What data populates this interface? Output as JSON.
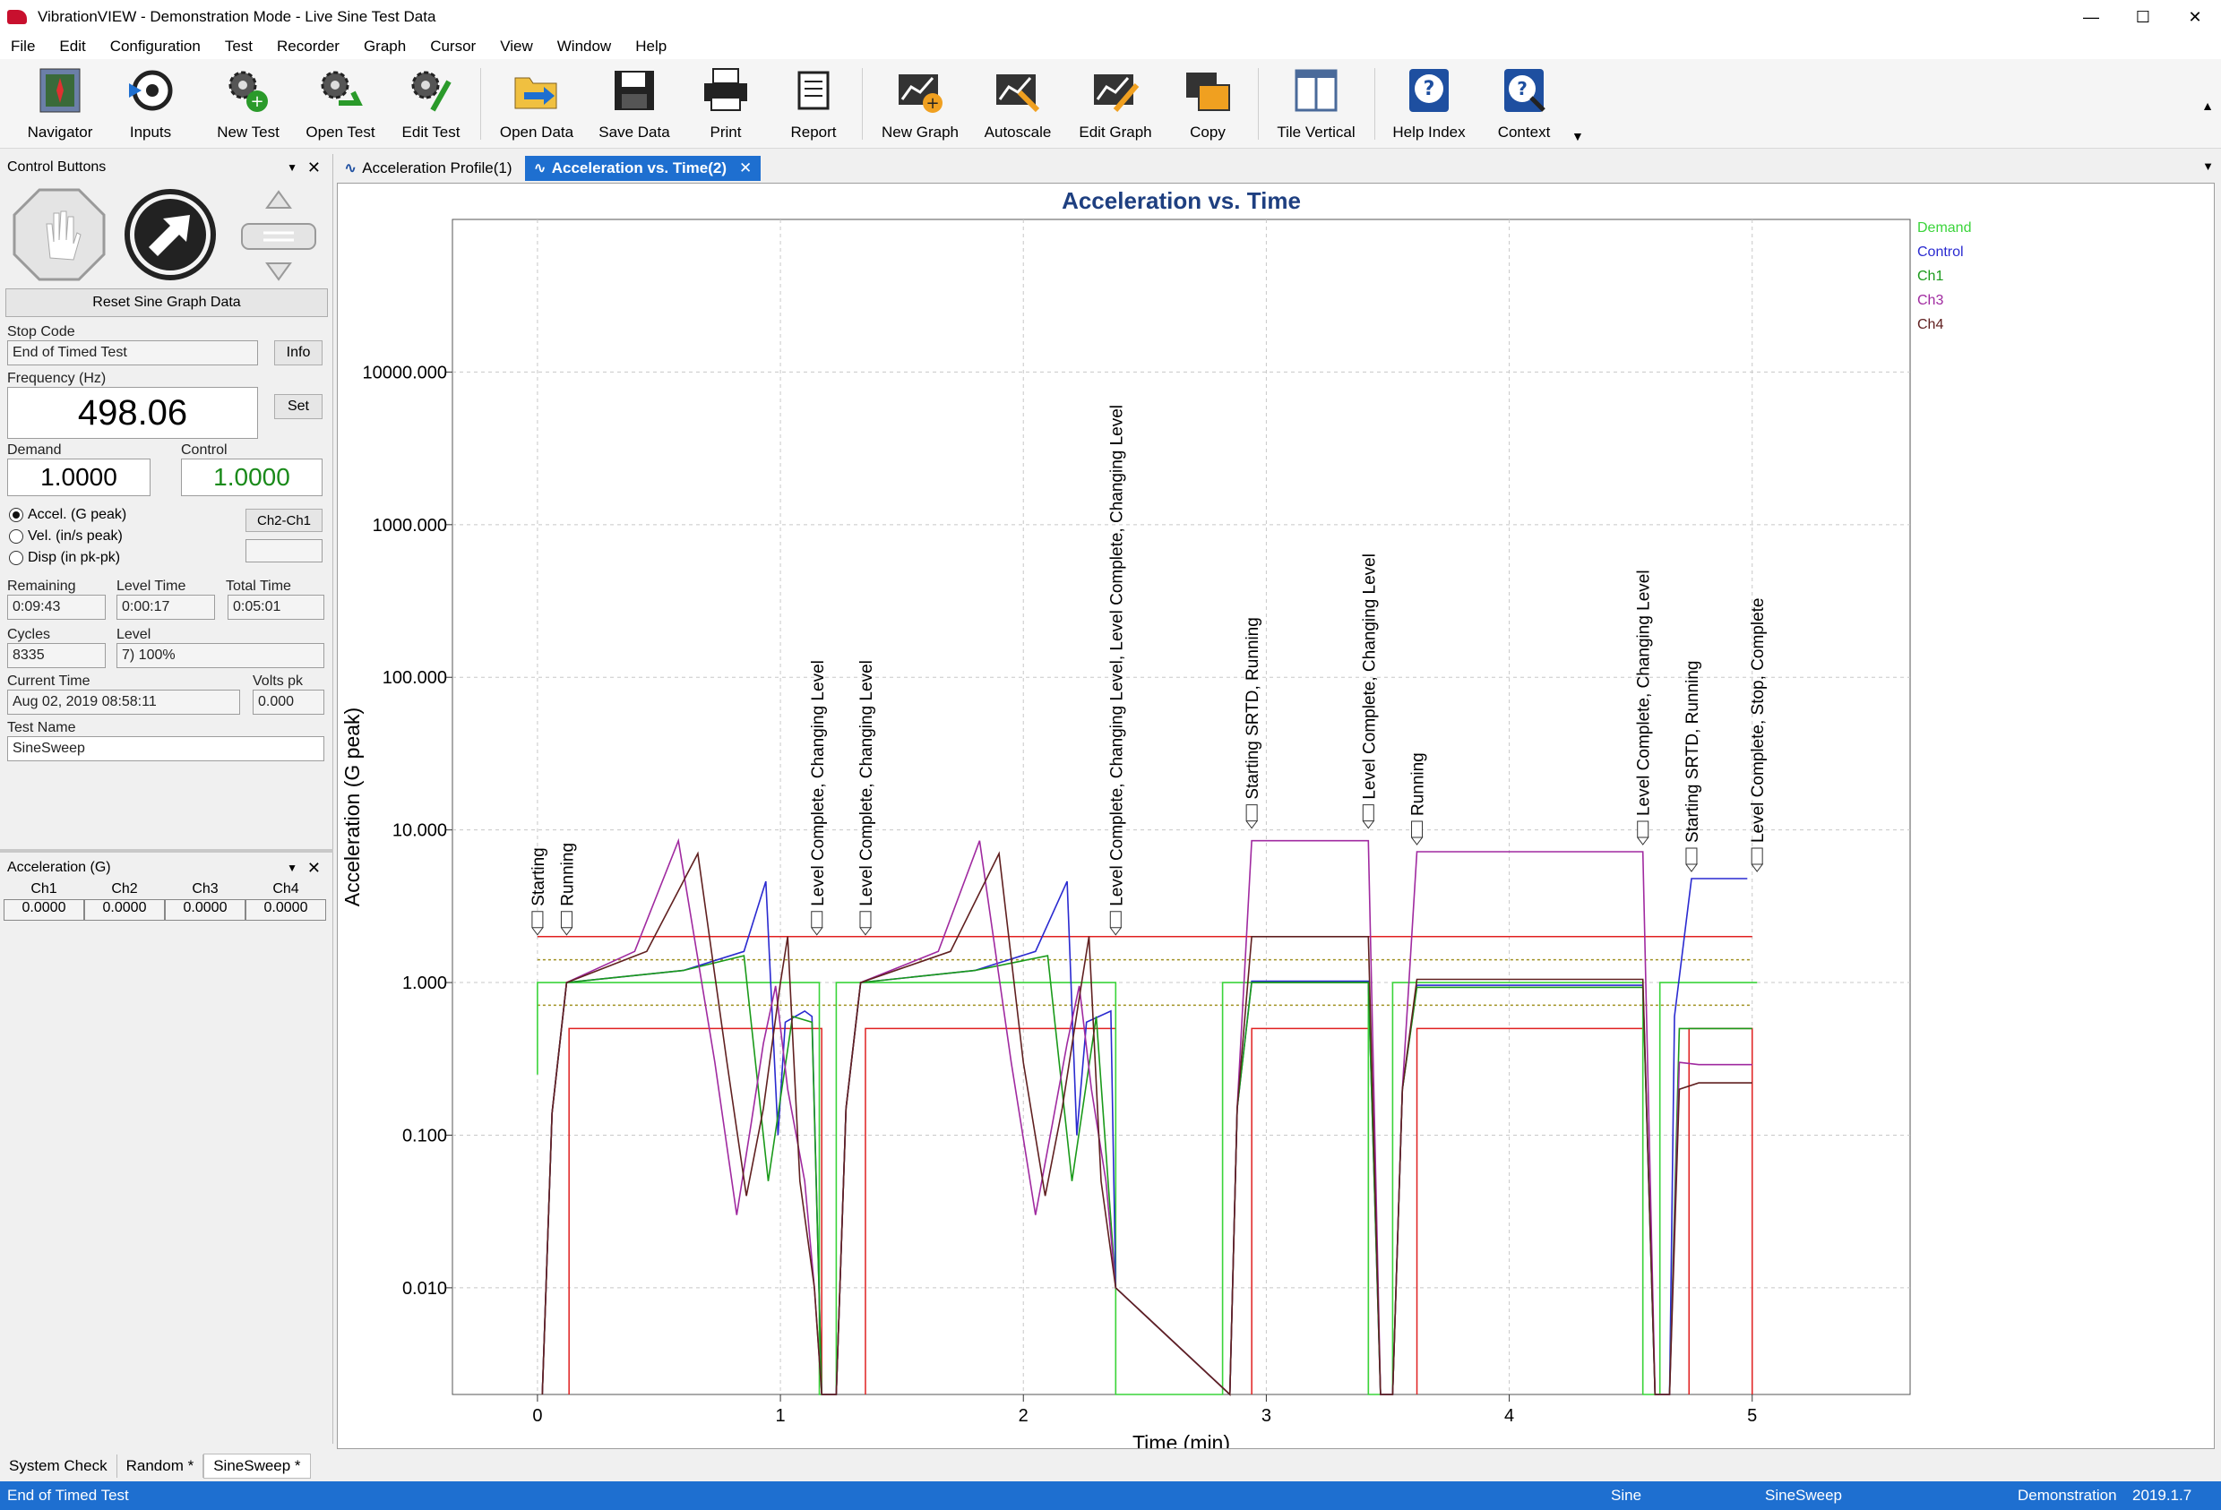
{
  "window": {
    "title": "VibrationVIEW - Demonstration Mode - Live Sine Test Data"
  },
  "menu": [
    "File",
    "Edit",
    "Configuration",
    "Test",
    "Recorder",
    "Graph",
    "Cursor",
    "View",
    "Window",
    "Help"
  ],
  "toolbar": {
    "navigator": "Navigator",
    "inputs": "Inputs",
    "new_test": "New Test",
    "open_test": "Open Test",
    "edit_test": "Edit Test",
    "open_data": "Open Data",
    "save_data": "Save Data",
    "print": "Print",
    "report": "Report",
    "new_graph": "New Graph",
    "autoscale": "Autoscale",
    "edit_graph": "Edit Graph",
    "copy": "Copy",
    "tile_vertical": "Tile Vertical",
    "help_index": "Help Index",
    "context": "Context"
  },
  "control_panel": {
    "title": "Control Buttons",
    "reset_label": "Reset Sine Graph Data",
    "stop_code_label": "Stop Code",
    "stop_code": "End of Timed Test",
    "info": "Info",
    "frequency_label": "Frequency (Hz)",
    "frequency": "498.06",
    "set": "Set",
    "demand_label": "Demand",
    "demand": "1.0000",
    "control_label": "Control",
    "control": "1.0000",
    "units": [
      "Accel.  (G peak)",
      "Vel.  (in/s peak)",
      "Disp (in pk-pk)"
    ],
    "ch_diff": "Ch2-Ch1",
    "remaining_label": "Remaining",
    "remaining": "0:09:43",
    "level_time_label": "Level Time",
    "level_time": "0:00:17",
    "total_time_label": "Total Time",
    "total_time": "0:05:01",
    "cycles_label": "Cycles",
    "cycles": "8335",
    "level_label": "Level",
    "level": "7) 100%",
    "current_time_label": "Current Time",
    "current_time": "Aug 02, 2019 08:58:11",
    "volts_label": "Volts pk",
    "volts": "0.000",
    "test_name_label": "Test Name",
    "test_name": "SineSweep"
  },
  "accel_panel": {
    "title": "Acceleration (G)",
    "headers": [
      "Ch1",
      "Ch2",
      "Ch3",
      "Ch4"
    ],
    "values": [
      "0.0000",
      "0.0000",
      "0.0000",
      "0.0000"
    ]
  },
  "doc_tabs": [
    "Acceleration Profile(1)",
    "Acceleration vs. Time(2)"
  ],
  "chart_data": {
    "type": "line",
    "title": "Acceleration vs. Time",
    "xlabel": "Time (min)",
    "ylabel": "Acceleration (G peak)",
    "xlim": [
      -0.35,
      5.65
    ],
    "ylim": [
      0.002,
      100000
    ],
    "yscale": "log",
    "grid": true,
    "legend_position": "right",
    "xticks": [
      "0",
      "1",
      "2",
      "3",
      "4",
      "5"
    ],
    "yticks": [
      "0.010",
      "0.100",
      "1.000",
      "10.000",
      "100.000",
      "1000.000",
      "10000.000"
    ],
    "colors": {
      "Demand": "#3ad43a",
      "Control": "#2a2ad0",
      "Ch1": "#1a9a1a",
      "Ch2": "#3a2aa0",
      "Ch3": "#a02aa0",
      "Ch4": "#602020",
      "limit": "#e02020",
      "alarm": "#a09020"
    },
    "series": [
      {
        "name": "Demand",
        "points": [
          [
            0,
            0.25
          ],
          [
            0,
            1
          ],
          [
            1.16,
            1
          ],
          [
            1.16,
            0.002
          ],
          [
            1.23,
            0.002
          ],
          [
            1.23,
            1
          ],
          [
            2.38,
            1
          ],
          [
            2.38,
            0.002
          ],
          [
            2.82,
            0.002
          ],
          [
            2.82,
            1
          ],
          [
            3.42,
            1
          ],
          [
            3.42,
            0.002
          ],
          [
            3.52,
            0.002
          ],
          [
            3.52,
            1
          ],
          [
            4.55,
            1
          ],
          [
            4.55,
            0.002
          ],
          [
            4.62,
            0.002
          ],
          [
            4.62,
            1
          ],
          [
            5.02,
            1
          ]
        ]
      },
      {
        "name": "Control",
        "points": [
          [
            0.02,
            0.002
          ],
          [
            0.06,
            0.14
          ],
          [
            0.12,
            1.0
          ],
          [
            0.6,
            1.2
          ],
          [
            0.85,
            1.6
          ],
          [
            0.94,
            4.6
          ],
          [
            0.99,
            0.1
          ],
          [
            1.02,
            0.55
          ],
          [
            1.1,
            0.65
          ],
          [
            1.13,
            0.6
          ],
          [
            1.17,
            0.002
          ],
          [
            1.23,
            0.002
          ],
          [
            1.27,
            0.15
          ],
          [
            1.33,
            1.0
          ],
          [
            1.8,
            1.2
          ],
          [
            2.05,
            1.6
          ],
          [
            2.18,
            4.6
          ],
          [
            2.22,
            0.1
          ],
          [
            2.26,
            0.55
          ],
          [
            2.36,
            0.65
          ],
          [
            2.38,
            0.01
          ],
          [
            2.85,
            0.002
          ],
          [
            2.88,
            0.15
          ],
          [
            2.94,
            1.02
          ],
          [
            3.42,
            1.02
          ],
          [
            3.47,
            0.002
          ],
          [
            3.52,
            0.002
          ],
          [
            3.56,
            0.2
          ],
          [
            3.62,
            0.96
          ],
          [
            4.55,
            0.96
          ],
          [
            4.6,
            0.002
          ],
          [
            4.66,
            0.002
          ],
          [
            4.68,
            0.6
          ],
          [
            4.75,
            4.8
          ],
          [
            4.98,
            4.8
          ]
        ]
      },
      {
        "name": "Ch1",
        "points": [
          [
            0.02,
            0.002
          ],
          [
            0.06,
            0.14
          ],
          [
            0.12,
            1.0
          ],
          [
            0.6,
            1.2
          ],
          [
            0.85,
            1.5
          ],
          [
            0.95,
            0.05
          ],
          [
            1.05,
            0.6
          ],
          [
            1.13,
            0.55
          ],
          [
            1.17,
            0.002
          ],
          [
            1.23,
            0.002
          ],
          [
            1.27,
            0.15
          ],
          [
            1.33,
            1.0
          ],
          [
            1.8,
            1.2
          ],
          [
            2.1,
            1.5
          ],
          [
            2.2,
            0.05
          ],
          [
            2.3,
            0.6
          ],
          [
            2.38,
            0.01
          ],
          [
            2.85,
            0.002
          ],
          [
            2.88,
            0.15
          ],
          [
            2.94,
            1.0
          ],
          [
            3.42,
            1.0
          ],
          [
            3.47,
            0.002
          ],
          [
            3.52,
            0.002
          ],
          [
            3.56,
            0.2
          ],
          [
            3.62,
            0.93
          ],
          [
            4.55,
            0.93
          ],
          [
            4.6,
            0.002
          ],
          [
            4.66,
            0.002
          ],
          [
            4.7,
            0.5
          ],
          [
            4.78,
            0.5
          ],
          [
            5.0,
            0.5
          ]
        ]
      },
      {
        "name": "Ch3",
        "points": [
          [
            0.02,
            0.002
          ],
          [
            0.06,
            0.14
          ],
          [
            0.12,
            1.0
          ],
          [
            0.4,
            1.6
          ],
          [
            0.58,
            8.5
          ],
          [
            0.73,
            0.3
          ],
          [
            0.82,
            0.03
          ],
          [
            0.88,
            0.12
          ],
          [
            0.93,
            0.4
          ],
          [
            0.98,
            0.95
          ],
          [
            1.03,
            0.2
          ],
          [
            1.1,
            0.05
          ],
          [
            1.14,
            0.01
          ],
          [
            1.17,
            0.002
          ],
          [
            1.23,
            0.002
          ],
          [
            1.27,
            0.15
          ],
          [
            1.33,
            1.0
          ],
          [
            1.65,
            1.6
          ],
          [
            1.82,
            8.5
          ],
          [
            1.95,
            0.3
          ],
          [
            2.05,
            0.03
          ],
          [
            2.12,
            0.12
          ],
          [
            2.18,
            0.4
          ],
          [
            2.23,
            0.95
          ],
          [
            2.28,
            0.2
          ],
          [
            2.34,
            0.05
          ],
          [
            2.38,
            0.01
          ],
          [
            2.85,
            0.002
          ],
          [
            2.88,
            0.15
          ],
          [
            2.94,
            8.5
          ],
          [
            3.42,
            8.5
          ],
          [
            3.47,
            0.002
          ],
          [
            3.52,
            0.002
          ],
          [
            3.56,
            0.2
          ],
          [
            3.62,
            7.2
          ],
          [
            4.55,
            7.2
          ],
          [
            4.6,
            0.002
          ],
          [
            4.66,
            0.002
          ],
          [
            4.7,
            0.3
          ],
          [
            4.78,
            0.29
          ],
          [
            5.0,
            0.29
          ]
        ]
      },
      {
        "name": "Ch4",
        "points": [
          [
            0.02,
            0.002
          ],
          [
            0.06,
            0.14
          ],
          [
            0.12,
            1.0
          ],
          [
            0.45,
            1.6
          ],
          [
            0.66,
            7.0
          ],
          [
            0.78,
            0.3
          ],
          [
            0.86,
            0.04
          ],
          [
            0.93,
            0.15
          ],
          [
            1.0,
            1.0
          ],
          [
            1.03,
            2.0
          ],
          [
            1.08,
            0.05
          ],
          [
            1.14,
            0.01
          ],
          [
            1.17,
            0.002
          ],
          [
            1.23,
            0.002
          ],
          [
            1.27,
            0.15
          ],
          [
            1.33,
            1.0
          ],
          [
            1.7,
            1.6
          ],
          [
            1.9,
            7.0
          ],
          [
            2.0,
            0.3
          ],
          [
            2.09,
            0.04
          ],
          [
            2.16,
            0.15
          ],
          [
            2.24,
            1.0
          ],
          [
            2.27,
            2.0
          ],
          [
            2.32,
            0.05
          ],
          [
            2.38,
            0.01
          ],
          [
            2.85,
            0.002
          ],
          [
            2.88,
            0.15
          ],
          [
            2.94,
            2.0
          ],
          [
            3.42,
            2.0
          ],
          [
            3.47,
            0.002
          ],
          [
            3.52,
            0.002
          ],
          [
            3.56,
            0.2
          ],
          [
            3.62,
            1.05
          ],
          [
            4.55,
            1.05
          ],
          [
            4.6,
            0.002
          ],
          [
            4.66,
            0.002
          ],
          [
            4.7,
            0.2
          ],
          [
            4.78,
            0.22
          ],
          [
            5.0,
            0.22
          ]
        ]
      }
    ],
    "limits": [
      {
        "name": "abort-high",
        "value": 2.0,
        "from": 0,
        "to": 5.0
      },
      {
        "name": "alarm-high",
        "value": 1.41,
        "from": 0,
        "to": 5.0
      },
      {
        "name": "alarm-low",
        "value": 0.71,
        "from": 0,
        "to": 5.0
      }
    ],
    "low_limit_steps": [
      [
        0.13,
        0.5,
        1.17
      ],
      [
        1.35,
        0.5,
        2.38
      ],
      [
        2.94,
        0.5,
        3.42
      ],
      [
        3.62,
        0.5,
        4.55
      ],
      [
        4.74,
        0.5,
        5.0
      ]
    ],
    "events": [
      {
        "x": 0.0,
        "y": 2.0,
        "label": "Starting"
      },
      {
        "x": 0.12,
        "y": 2.0,
        "label": "Running"
      },
      {
        "x": 1.15,
        "y": 2.0,
        "label": "Level Complete, Changing Level"
      },
      {
        "x": 1.35,
        "y": 2.0,
        "label": "Level Complete, Changing Level"
      },
      {
        "x": 2.38,
        "y": 2.0,
        "label": "Level Complete, Changing Level, Level Complete, Changing Level"
      },
      {
        "x": 2.94,
        "y": 10.0,
        "label": "Starting SRTD, Running"
      },
      {
        "x": 3.42,
        "y": 10.0,
        "label": "Level Complete, Changing Level"
      },
      {
        "x": 3.62,
        "y": 7.8,
        "label": "Running"
      },
      {
        "x": 4.55,
        "y": 7.8,
        "label": "Level Complete, Changing Level"
      },
      {
        "x": 4.75,
        "y": 5.2,
        "label": "Starting SRTD, Running"
      },
      {
        "x": 5.02,
        "y": 5.2,
        "label": "Level Complete, Stop, Complete"
      }
    ]
  },
  "bottom_tabs": [
    "System Check",
    "Random *",
    "SineSweep *"
  ],
  "status": {
    "left": "End of Timed Test",
    "mode": "Sine",
    "test": "SineSweep",
    "demo": "Demonstration",
    "version": "2019.1.7"
  }
}
